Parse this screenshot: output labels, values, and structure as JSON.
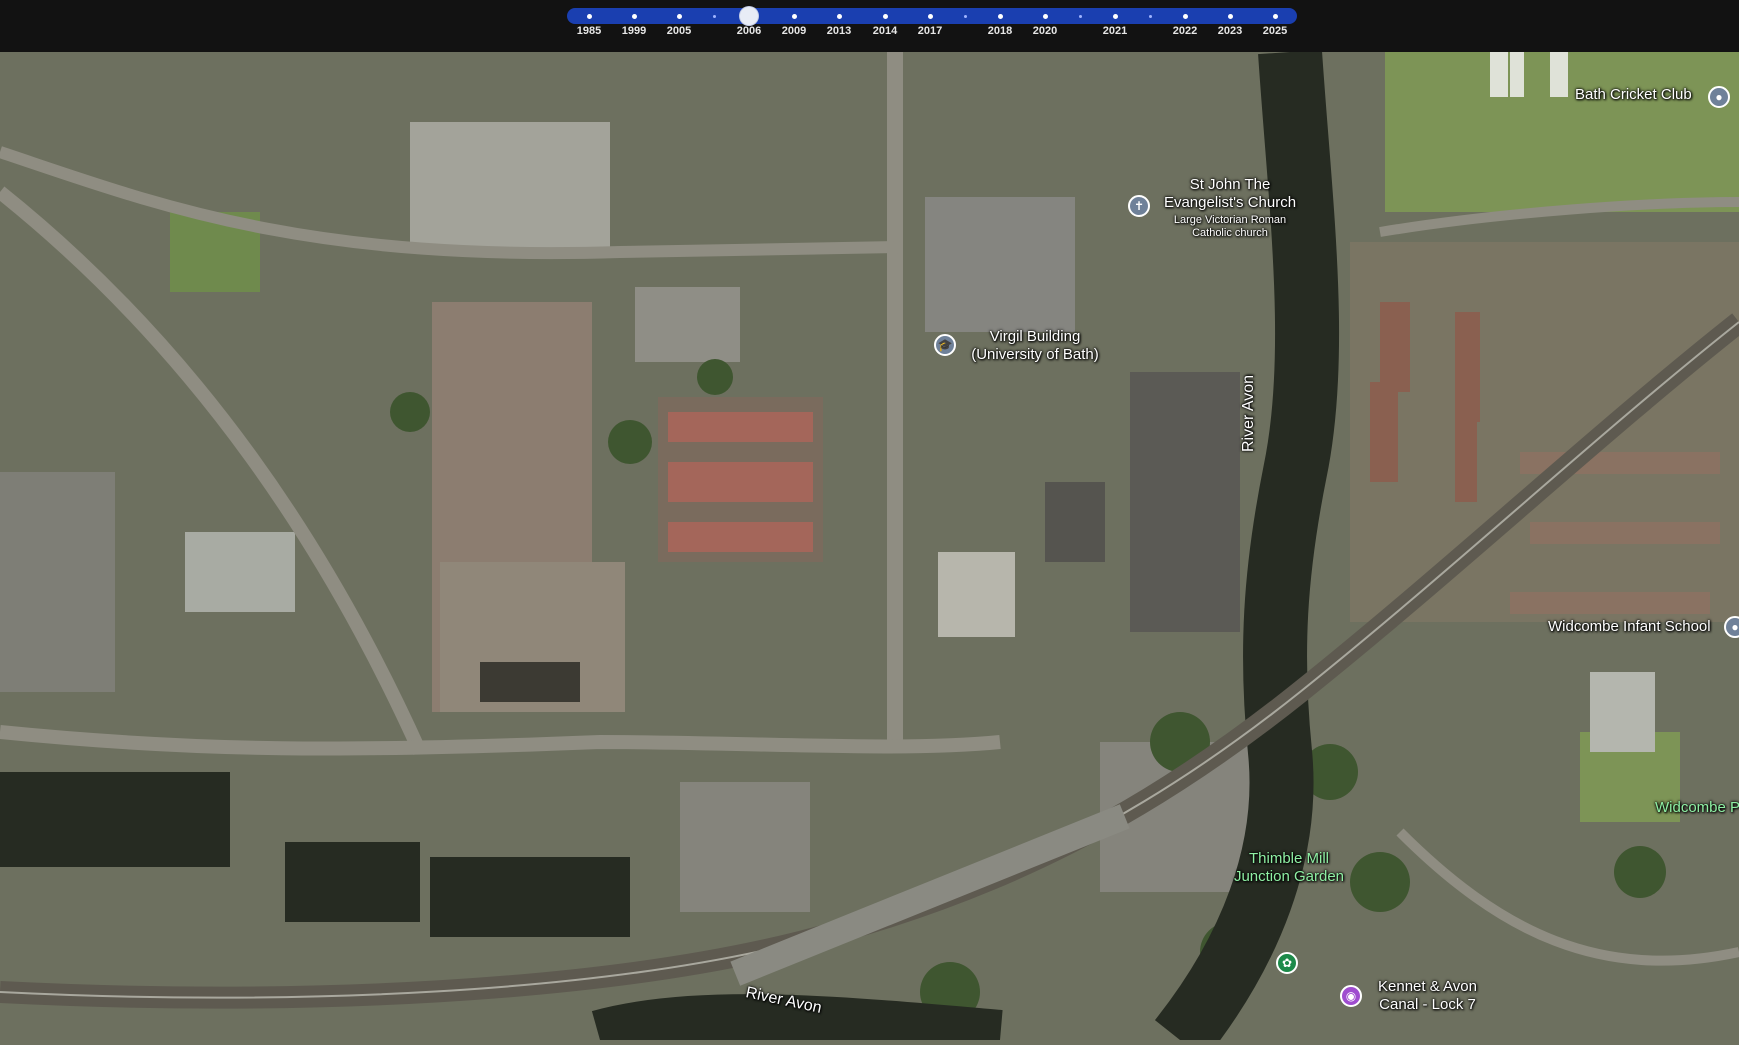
{
  "timeline": {
    "selected_year": "2006",
    "years": [
      "1985",
      "1999",
      "2005",
      "2006",
      "2009",
      "2013",
      "2014",
      "2017",
      "2018",
      "2020",
      "2021",
      "2022",
      "2023",
      "2025"
    ]
  },
  "map": {
    "colors": {
      "water": "#262b22",
      "railway": "#5e5a50",
      "road": "#8f8d82",
      "grass": "#7d9456",
      "roof_red": "#a4665a"
    },
    "places": {
      "bath_cricket_club": "Bath Cricket Club",
      "st_john_church": "St John The\nEvangelist's Church",
      "st_john_church_desc": "Large Victorian Roman\nCatholic church",
      "virgil_building": "Virgil Building\n(University of Bath)",
      "river_avon_east": "River Avon",
      "river_avon_south": "River Avon",
      "widcombe_infant_school": "Widcombe Infant School",
      "widcombe_partial": "Widcombe P",
      "thimble_mill": "Thimble Mill\nJunction Garden",
      "kennet_avon_lock": "Kennet & Avon\nCanal - Lock 7"
    },
    "icons": {
      "cricket_pin": "location-pin-icon",
      "church_pin": "church-cross-icon",
      "university_pin": "graduation-cap-icon",
      "school_pin": "school-icon",
      "garden_pin": "flower-icon",
      "camera_pin": "camera-icon"
    }
  }
}
